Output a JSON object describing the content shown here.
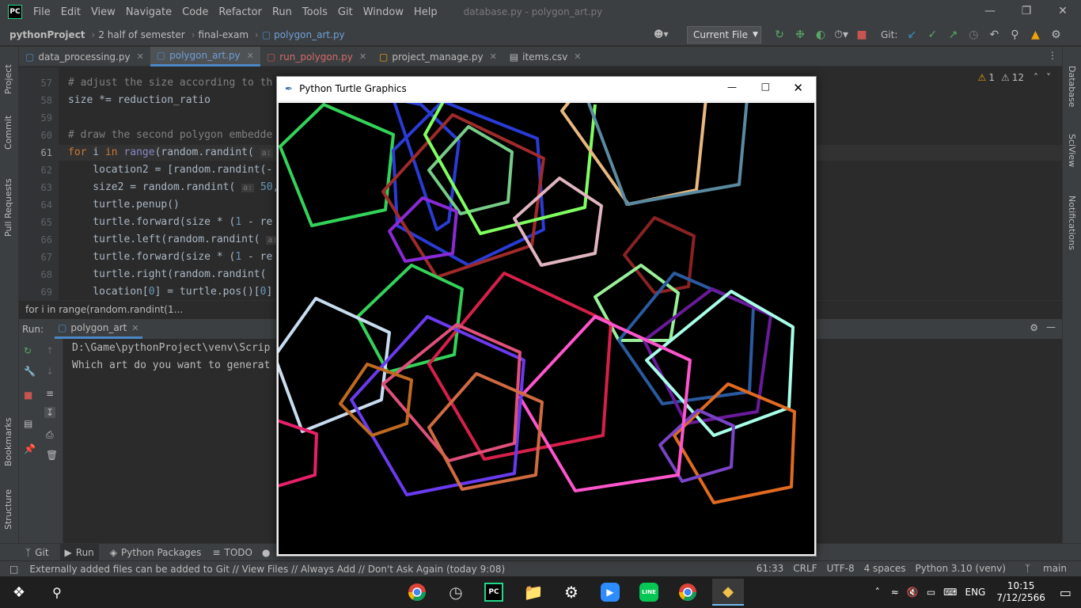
{
  "menu": {
    "app_logo": "PC",
    "items": [
      "File",
      "Edit",
      "View",
      "Navigate",
      "Code",
      "Refactor",
      "Run",
      "Tools",
      "Git",
      "Window",
      "Help"
    ],
    "window_title": "database.py - polygon_art.py"
  },
  "navbar": {
    "breadcrumb": [
      "pythonProject",
      "2 half of",
      "semester",
      "final-exam",
      "polygon_art.py"
    ],
    "run_config": "Current File",
    "git_label": "Git:"
  },
  "tabs": [
    {
      "label": "data_processing.py",
      "active": false
    },
    {
      "label": "polygon_art.py",
      "active": true
    },
    {
      "label": "run_polygon.py",
      "active": false
    },
    {
      "label": "project_manage.py",
      "active": false
    },
    {
      "label": "items.csv",
      "active": false
    }
  ],
  "left_strip": [
    "Project",
    "Commit",
    "Pull Requests",
    "Bookmarks",
    "Structure"
  ],
  "right_strip": [
    "Database",
    "SciView",
    "Notifications"
  ],
  "editor": {
    "line_numbers": [
      "57",
      "58",
      "59",
      "60",
      "61",
      "62",
      "63",
      "64",
      "65",
      "66",
      "67",
      "68",
      "69"
    ],
    "warnings": "1",
    "weak_warnings": "12",
    "breadcrumb_footer": "for i in range(random.randint(1..."
  },
  "run": {
    "label": "Run:",
    "config_tab": "polygon_art",
    "output": [
      "D:\\Game\\pythonProject\\venv\\Scrip",
      "Which art do you want to generat"
    ]
  },
  "bottom_tools": [
    "Git",
    "Run",
    "Python Packages",
    "TODO"
  ],
  "status": {
    "message": "Externally added files can be added to Git // View Files // Always Add // Don't Ask Again (today 9:08)",
    "position": "61:33",
    "line_sep": "CRLF",
    "encoding": "UTF-8",
    "indent": "4 spaces",
    "interpreter": "Python 3.10 (venv)",
    "branch": "main"
  },
  "taskbar": {
    "language": "ENG",
    "time": "10:15",
    "date": "7/12/2566"
  },
  "turtle_window": {
    "title": "Python Turtle Graphics"
  }
}
